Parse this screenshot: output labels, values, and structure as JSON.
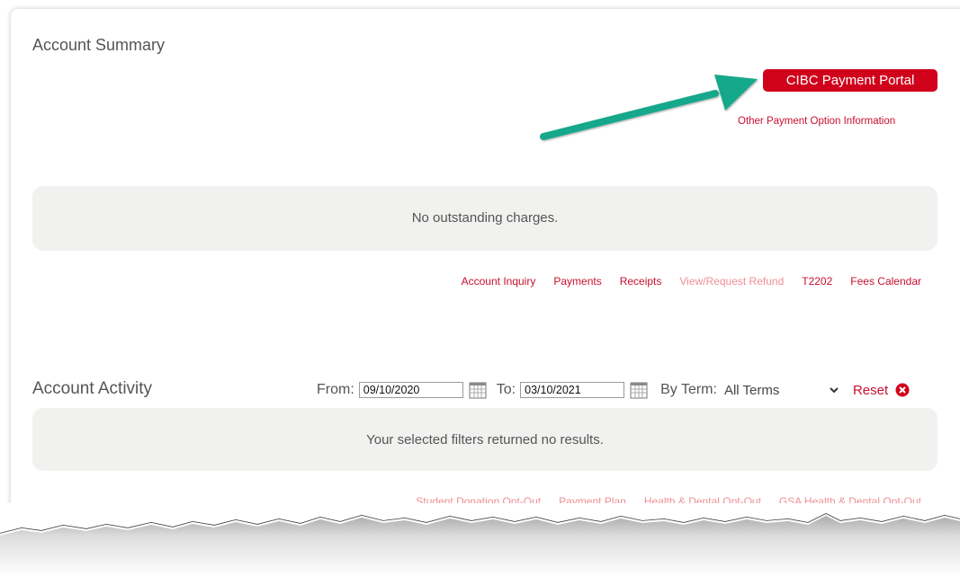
{
  "account_summary": {
    "title": "Account Summary",
    "portal_button_label": "CIBC Payment Portal",
    "other_payment_link": "Other Payment Option Information",
    "no_charges_text": "No outstanding charges.",
    "links": [
      {
        "label": "Account Inquiry",
        "disabled": false
      },
      {
        "label": "Payments",
        "disabled": false
      },
      {
        "label": "Receipts",
        "disabled": false
      },
      {
        "label": "View/Request Refund",
        "disabled": true
      },
      {
        "label": "T2202",
        "disabled": false
      },
      {
        "label": "Fees Calendar",
        "disabled": false
      }
    ]
  },
  "account_activity": {
    "title": "Account Activity",
    "from_label": "From:",
    "from_value": "09/10/2020",
    "to_label": "To:",
    "to_value": "03/10/2021",
    "term_label": "By Term:",
    "term_value": "All Terms",
    "reset_label": "Reset",
    "no_results_text": "Your selected filters returned no results.",
    "links": [
      {
        "label": "Student Donation Opt-Out"
      },
      {
        "label": "Payment Plan"
      },
      {
        "label": "Health & Dental Opt-Out"
      },
      {
        "label": "GSA Health & Dental Opt-Out"
      }
    ]
  },
  "icons": {
    "annotation_arrow": "arrow-icon",
    "calendar": "calendar-icon",
    "dropdown": "chevron-down-icon",
    "reset": "close-circle-icon"
  },
  "colors": {
    "brand_red": "#d0021b",
    "link_red": "#c8102e",
    "disabled_link": "#ef8f96",
    "annotation_arrow": "#17a88a",
    "panel_bg": "#f1f1f0",
    "text_gray": "#555555"
  }
}
